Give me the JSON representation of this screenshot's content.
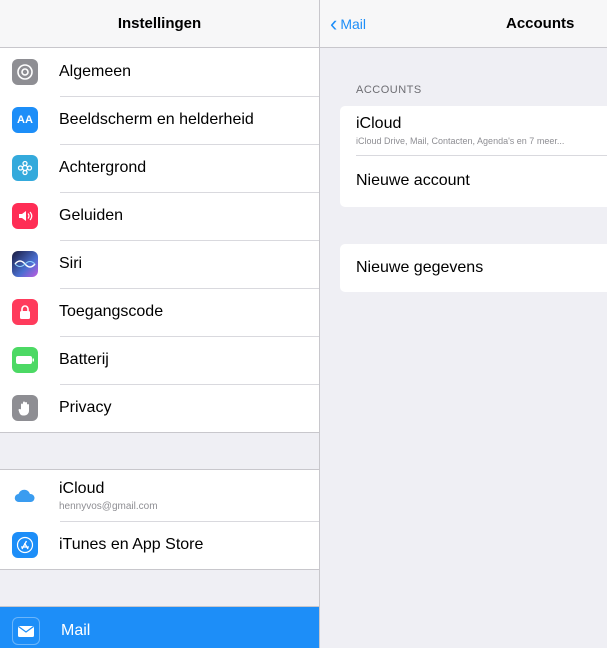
{
  "sidebar": {
    "title": "Instellingen",
    "items": [
      {
        "label": "Algemeen",
        "icon": "gear-icon",
        "color": "#8e8e93"
      },
      {
        "label": "Beeldscherm en helderheid",
        "icon": "display-brightness-icon",
        "color": "#1d8ef8"
      },
      {
        "label": "Achtergrond",
        "icon": "wallpaper-icon",
        "color": "#34aadc"
      },
      {
        "label": "Geluiden",
        "icon": "speaker-icon",
        "color": "#ff2d55"
      },
      {
        "label": "Siri",
        "icon": "siri-icon",
        "color": "#2b2e6b"
      },
      {
        "label": "Toegangscode",
        "icon": "lock-icon",
        "color": "#ff3b5c"
      },
      {
        "label": "Batterij",
        "icon": "battery-icon",
        "color": "#4cd964"
      },
      {
        "label": "Privacy",
        "icon": "hand-icon",
        "color": "#8e8e93"
      }
    ],
    "accounts": [
      {
        "label": "iCloud",
        "sub": "hennyvos@gmail.com",
        "icon": "icloud-icon",
        "color": "#ffffff"
      },
      {
        "label": "iTunes en App Store",
        "icon": "app-store-icon",
        "color": "#1d8ef8"
      }
    ],
    "apps": [
      {
        "label": "Mail",
        "icon": "mail-icon",
        "color": "#1d8ef8",
        "selected": true
      }
    ]
  },
  "detail": {
    "back_label": "Mail",
    "title": "Accounts",
    "section_title": "ACCOUNTS",
    "accounts": [
      {
        "label": "iCloud",
        "sub": "iCloud Drive, Mail, Contacten, Agenda's en 7 meer..."
      },
      {
        "label": "Nieuwe account"
      }
    ],
    "fetch_label": "Nieuwe gegevens"
  },
  "colors": {
    "accent": "#1d8ef8",
    "background": "#efeff4"
  }
}
